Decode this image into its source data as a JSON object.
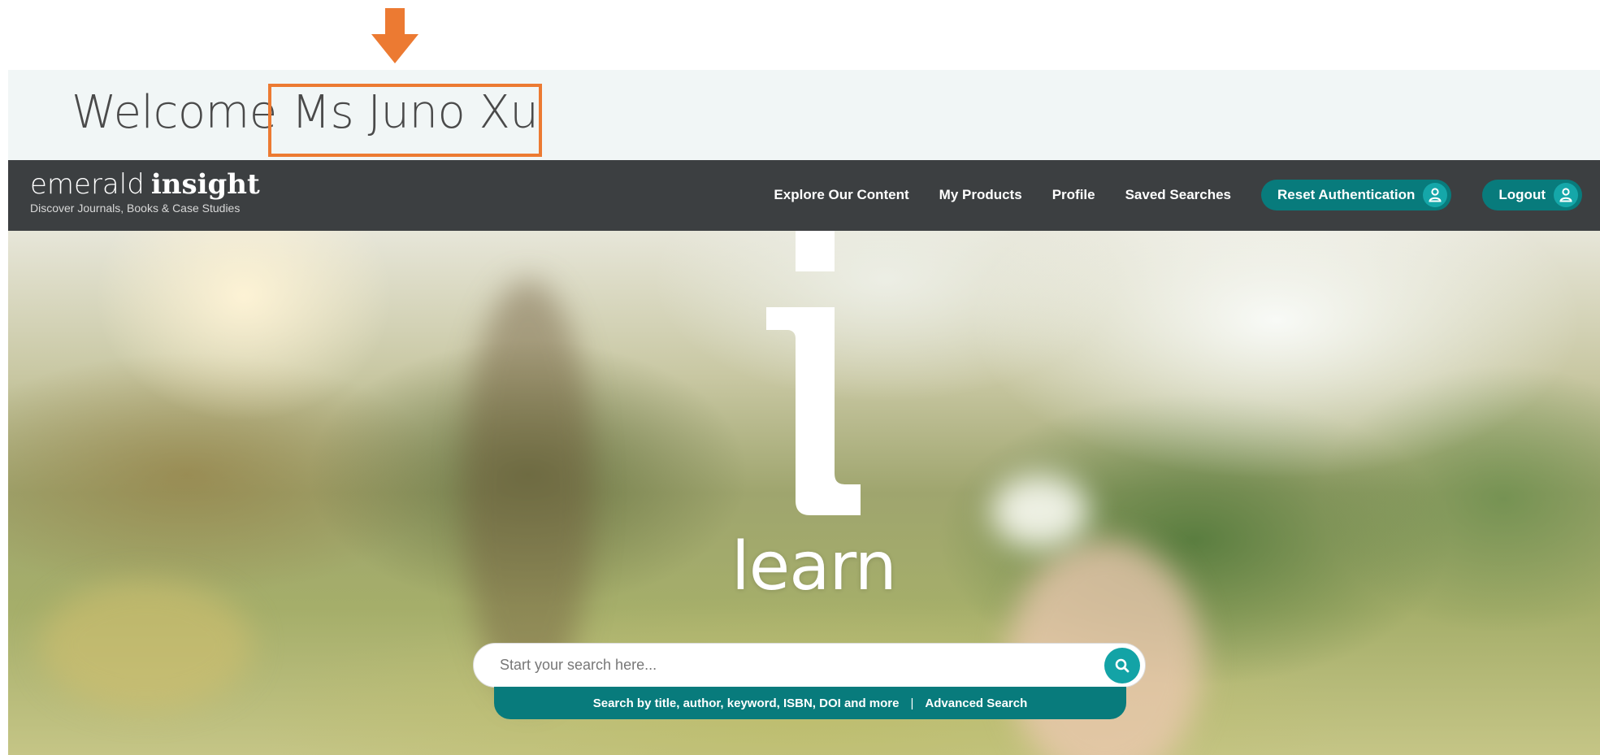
{
  "annotation": {
    "color": "#ec7a32",
    "arrow_icon": "down-arrow-icon"
  },
  "welcome": {
    "greeting": "Welcome",
    "user_name": "Ms Juno Xu"
  },
  "header": {
    "logo_light": "emerald",
    "logo_bold": "insight",
    "tagline": "Discover Journals, Books & Case Studies",
    "nav": [
      {
        "label": "Explore Our Content"
      },
      {
        "label": "My Products"
      },
      {
        "label": "Profile"
      },
      {
        "label": "Saved Searches"
      }
    ],
    "reset_auth_label": "Reset Authentication",
    "logout_label": "Logout",
    "accent": "#087b7c",
    "icon": "user-icon"
  },
  "hero": {
    "word": "learn"
  },
  "search": {
    "placeholder": "Start your search here...",
    "hint": "Search by title, author, keyword, ISBN, DOI and more",
    "separator": "|",
    "advanced_label": "Advanced Search",
    "button_icon": "search-icon"
  }
}
